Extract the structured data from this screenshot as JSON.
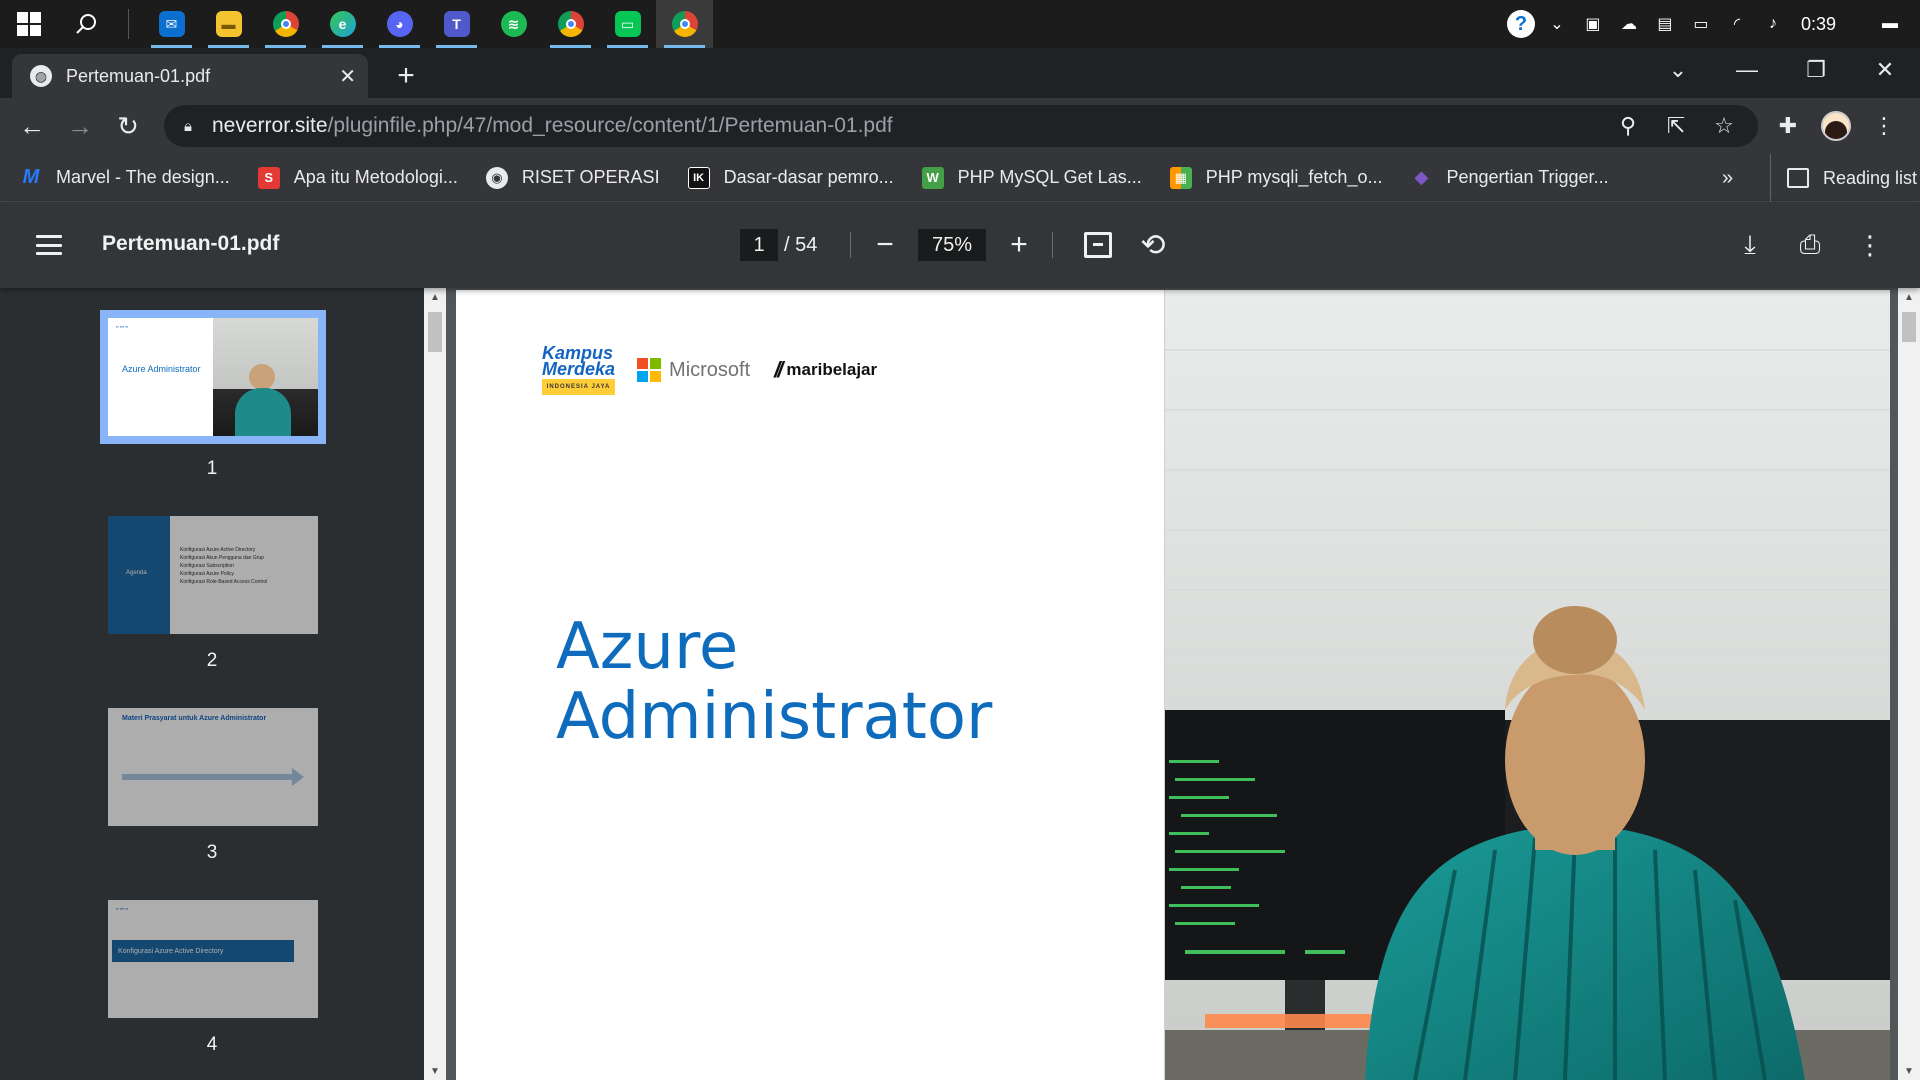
{
  "taskbar": {
    "apps": [
      {
        "name": "mail",
        "color": "#0a6fcf"
      },
      {
        "name": "file-explorer",
        "color": "#f4c430"
      },
      {
        "name": "chrome",
        "color": "#db4437"
      },
      {
        "name": "edge",
        "color": "#1fa1d9"
      },
      {
        "name": "discord",
        "color": "#5865f2"
      },
      {
        "name": "teams",
        "color": "#5059c9"
      },
      {
        "name": "spotify",
        "color": "#1db954"
      },
      {
        "name": "chrome-profile",
        "color": "#db4437"
      },
      {
        "name": "line",
        "color": "#06c755"
      },
      {
        "name": "chrome-active",
        "color": "#db4437"
      }
    ],
    "clock": "0:39"
  },
  "browser": {
    "tab_title": "Pertemuan-01.pdf",
    "url_host": "neverror.site",
    "url_path": "/pluginfile.php/47/mod_resource/content/1/Pertemuan-01.pdf"
  },
  "bookmarks": [
    {
      "label": "Marvel - The design...",
      "icon_text": "M",
      "color": "#2979ff"
    },
    {
      "label": "Apa itu Metodologi...",
      "icon_text": "S",
      "color": "#e53935"
    },
    {
      "label": "RISET OPERASI",
      "icon_text": "◉",
      "color": "#5f6368"
    },
    {
      "label": "Dasar-dasar pemro...",
      "icon_text": "IK",
      "color": "#111111"
    },
    {
      "label": "PHP MySQL Get Las...",
      "icon_text": "W",
      "color": "#43a047"
    },
    {
      "label": "PHP mysqli_fetch_o...",
      "icon_text": "▦",
      "color": "#ff9800"
    },
    {
      "label": "Pengertian Trigger...",
      "icon_text": "◆",
      "color": "#7e57c2"
    }
  ],
  "bookmarks_more": "»",
  "reading_list": "Reading list",
  "pdf": {
    "title": "Pertemuan-01.pdf",
    "current_page": "1",
    "total_pages": "/ 54",
    "zoom": "75%"
  },
  "thumbnails": [
    {
      "page": "1",
      "title": "Azure Administrator"
    },
    {
      "page": "2",
      "agenda": "Agenda",
      "items": [
        "Konfigurasi Azure Active Directory",
        "Konfigurasi Akun Pengguna dan Grup",
        "Konfigurasi Subscription",
        "Konfigurasi Azure Policy",
        "Konfigurasi Role-Based Access Control"
      ]
    },
    {
      "page": "3",
      "title": "Materi Prasyarat untuk Azure Administrator"
    },
    {
      "page": "4",
      "title": "Konfigurasi Azure Active Directory"
    }
  ],
  "slide": {
    "logo_km_1": "Kampus",
    "logo_km_2": "Merdeka",
    "logo_km_tag": "INDONESIA JAYA",
    "logo_ms": "Microsoft",
    "logo_mb": "maribelajar",
    "title_line1": "Azure",
    "title_line2": "Administrator"
  }
}
